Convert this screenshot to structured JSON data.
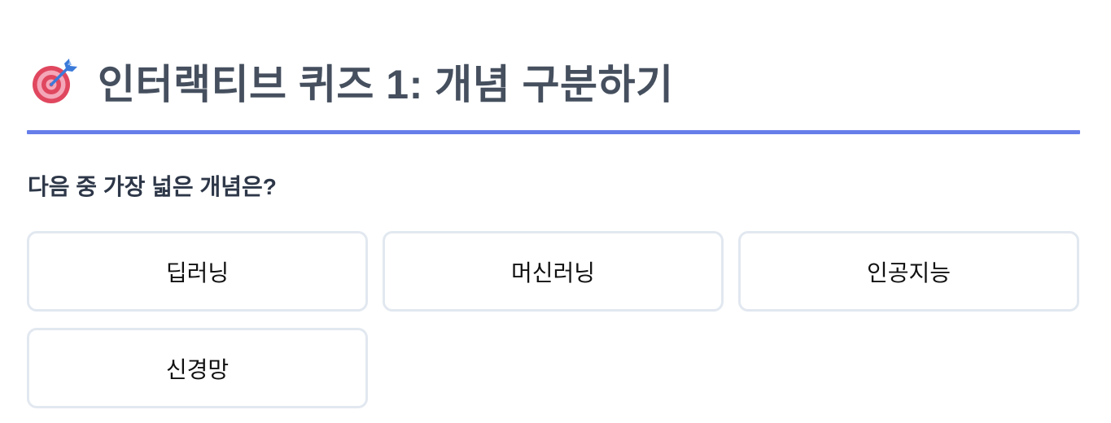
{
  "quiz": {
    "icon": "target-dart-icon",
    "title": "인터랙티브 퀴즈 1: 개념 구분하기",
    "question": "다음 중 가장 넓은 개념은?",
    "options": [
      {
        "label": "딥러닝"
      },
      {
        "label": "머신러닝"
      },
      {
        "label": "인공지능"
      },
      {
        "label": "신경망"
      }
    ]
  },
  "colors": {
    "accent": "#667eea",
    "title": "#454f5e",
    "option_border": "#e2e8f0",
    "background": "#ffffff"
  }
}
